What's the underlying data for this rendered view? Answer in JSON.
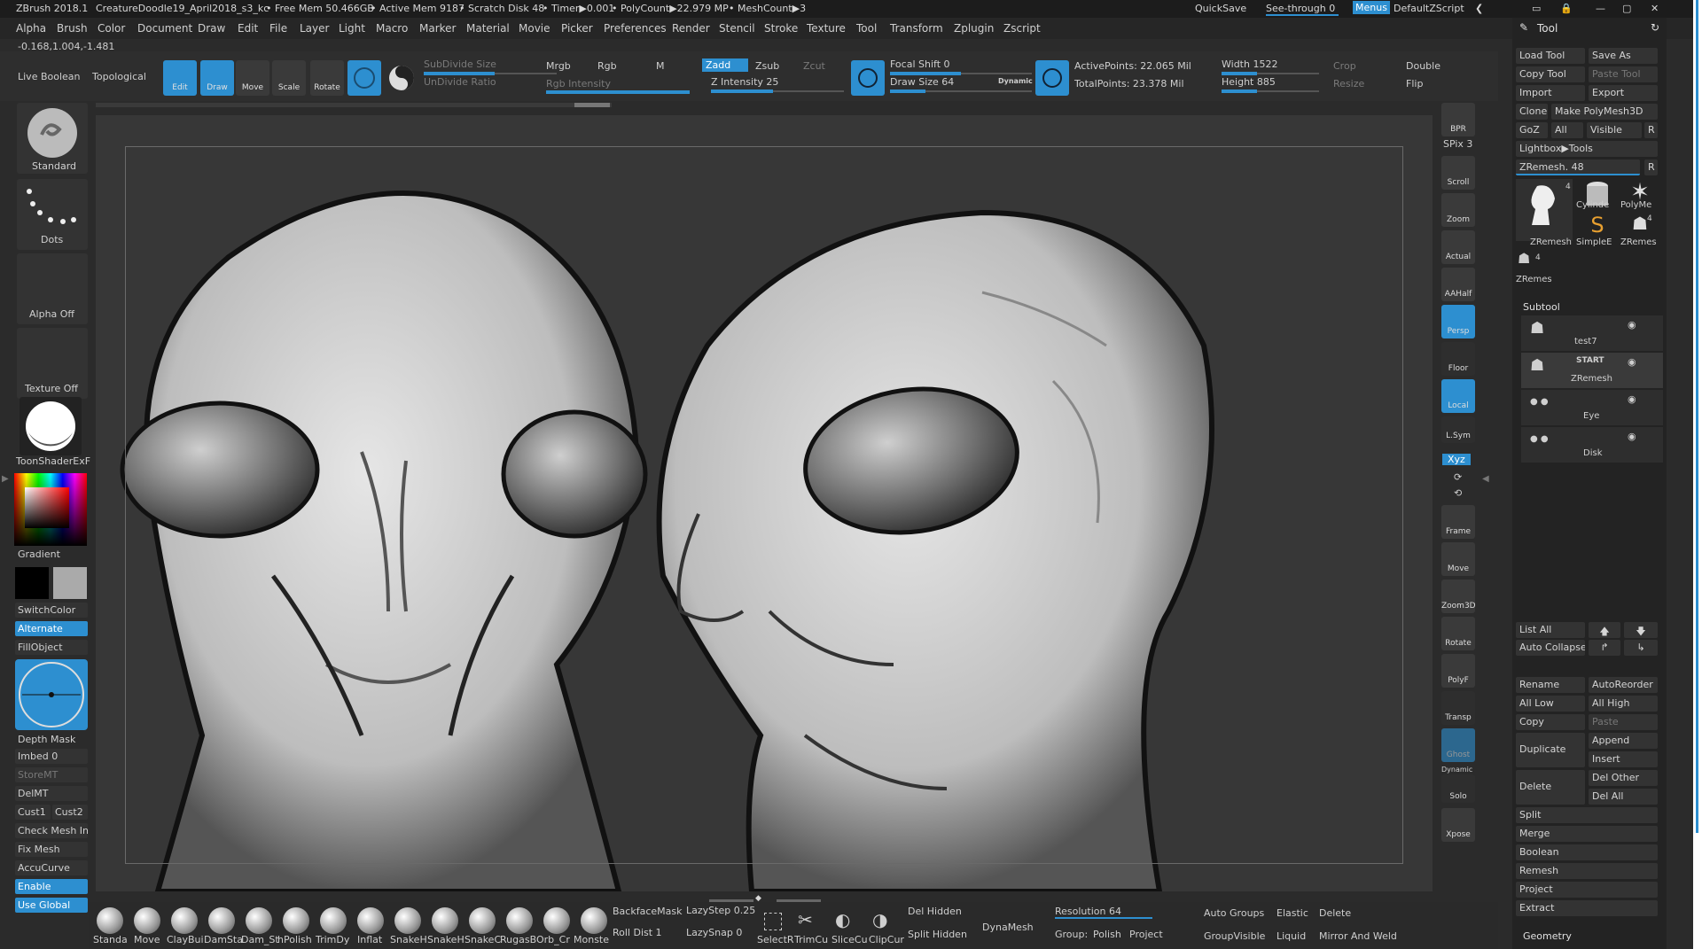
{
  "titlebar": {
    "app": "ZBrush 2018.1",
    "doc": "CreatureDoodle19_April2018_s3_kc",
    "freemem": "• Free Mem 50.466GB",
    "activemem": "• Active Mem 9187",
    "scratch": "• Scratch Disk 48",
    "timer": "• Timer▶0.001",
    "polycount": "• PolyCount▶22.979 MP",
    "meshcount": "• MeshCount▶3",
    "quicksave": "QuickSave",
    "seethrough": "See-through  0",
    "menus": "Menus",
    "script": "DefaultZScript"
  },
  "menu": [
    "Alpha",
    "Brush",
    "Color",
    "Document",
    "Draw",
    "Edit",
    "File",
    "Layer",
    "Light",
    "Macro",
    "Marker",
    "Material",
    "Movie",
    "Picker",
    "Preferences",
    "Render",
    "Stencil",
    "Stroke",
    "Texture",
    "Tool",
    "Transform",
    "Zplugin",
    "Zscript"
  ],
  "coords": "-0.168,1.004,-1.481",
  "toolbar": {
    "live_boolean": "Live Boolean",
    "topological": "Topological",
    "edit": "Edit",
    "draw": "Draw",
    "move": "Move",
    "scale": "Scale",
    "rotate": "Rotate",
    "subdivide_size": "SubDivide Size",
    "undivide_ratio": "UnDivide Ratio",
    "mrgb": "Mrgb",
    "rgb": "Rgb",
    "m": "M",
    "rgb_intensity": "Rgb Intensity",
    "zadd": "Zadd",
    "zsub": "Zsub",
    "zcut": "Zcut",
    "z_intensity": "Z Intensity 25",
    "focal_shift": "Focal Shift 0",
    "draw_size": "Draw Size 64",
    "dynamic": "Dynamic",
    "active_points": "ActivePoints: 22.065 Mil",
    "total_points": "TotalPoints: 23.378 Mil",
    "width": "Width 1522",
    "height": "Height 885",
    "crop": "Crop",
    "resize": "Resize",
    "double": "Double",
    "flip": "Flip"
  },
  "leftshelf": {
    "brush": "Standard",
    "stroke": "Dots",
    "alpha": "Alpha Off",
    "texture": "Texture Off",
    "material": "ToonShaderExF",
    "gradient": "Gradient",
    "switchcolor": "SwitchColor",
    "alternate": "Alternate",
    "fillobject": "FillObject",
    "depth_mask": "Depth Mask",
    "imbed": "Imbed 0",
    "storemt": "StoreMT",
    "delmt": "DelMT",
    "cust1": "Cust1",
    "cust2": "Cust2",
    "check_mesh": "Check Mesh In",
    "fix_mesh": "Fix Mesh",
    "accucurve": "AccuCurve",
    "enable": "Enable",
    "use_global": "Use Global"
  },
  "rightshelf": [
    "BPR",
    "SPix 3",
    "Scroll",
    "Zoom",
    "Actual",
    "AAHalf",
    "Persp",
    "Floor",
    "Local",
    "L.Sym",
    "Xyz",
    "Frame",
    "Move",
    "Zoom3D",
    "Rotate",
    "PolyF",
    "Transp",
    "Ghost",
    "Dynamic",
    "Solo",
    "Xpose"
  ],
  "toolpanel": {
    "title": "Tool",
    "load_tool": "Load Tool",
    "save_as": "Save As",
    "copy_tool": "Copy Tool",
    "paste_tool": "Paste Tool",
    "import": "Import",
    "export": "Export",
    "clone": "Clone",
    "make_polymesh": "Make PolyMesh3D",
    "goz": "GoZ",
    "all": "All",
    "visible": "Visible",
    "r": "R",
    "lightbox_tools": "Lightbox▶Tools",
    "zremesh": "ZRemesh. 48",
    "thumbs": [
      "ZRemesh",
      "Cylinde",
      "PolyMe",
      "SimpleE",
      "ZRemes",
      "ZRemes"
    ],
    "thumb_counts": [
      "4",
      "4",
      "4"
    ],
    "subtool": "Subtool",
    "subtools": [
      "test7",
      "ZRemesh",
      "Eye",
      "Disk"
    ],
    "start": "START",
    "list_all": "List All",
    "auto_collapse": "Auto Collapse",
    "rename": "Rename",
    "autoreorder": "AutoReorder",
    "all_low": "All Low",
    "all_high": "All High",
    "copy": "Copy",
    "paste": "Paste",
    "duplicate": "Duplicate",
    "append": "Append",
    "insert": "Insert",
    "delete": "Delete",
    "del_other": "Del Other",
    "del_all": "Del All",
    "split": "Split",
    "merge": "Merge",
    "boolean": "Boolean",
    "remesh": "Remesh",
    "project": "Project",
    "extract": "Extract",
    "geometry": "Geometry"
  },
  "bottom": {
    "brushes": [
      "Standa",
      "Move",
      "ClayBui",
      "DamSta",
      "Dam_St",
      "hPolish",
      "TrimDy",
      "Inflat",
      "SnakeH",
      "SnakeH",
      "SnakeC",
      "RugasB",
      "Orb_Cr",
      "Monste",
      "SelectR",
      "TrimCu",
      "SliceCu",
      "ClipCur"
    ],
    "backfacemask": "BackfaceMask",
    "roll_dist": "Roll Dist 1",
    "lazystep": "LazyStep 0.25",
    "lazysnap": "LazySnap 0",
    "del_hidden": "Del Hidden",
    "split_hidden": "Split Hidden",
    "dynamesh": "DynaMesh",
    "resolution": "Resolution 64",
    "group": "Group:",
    "polish": "Polish",
    "project": "Project",
    "auto_groups": "Auto Groups",
    "groupvisible": "GroupVisible",
    "elastic": "Elastic",
    "liquid": "Liquid",
    "delete": "Delete",
    "mirror_weld": "Mirror And Weld"
  },
  "colors": {
    "accent": "#2d8fd0",
    "bg": "#2b2b2b",
    "canvas": "#373737"
  }
}
